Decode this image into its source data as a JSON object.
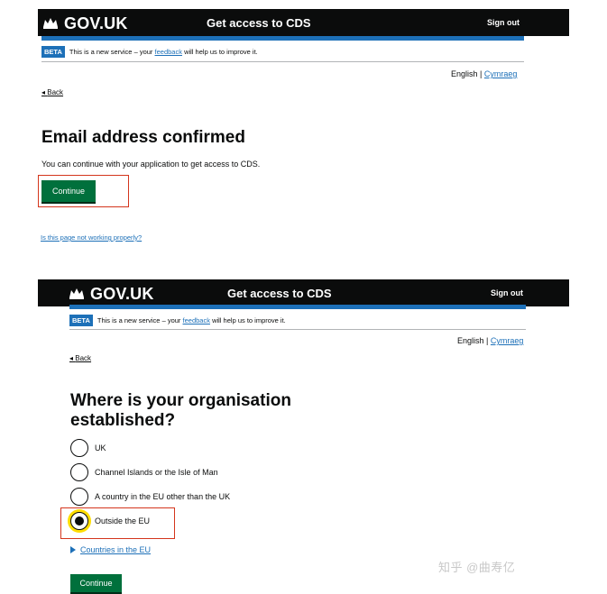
{
  "common": {
    "logo_text": "GOV.UK",
    "service_name": "Get access to CDS",
    "sign_out": "Sign out",
    "beta_tag": "BETA",
    "beta_prefix": "This is a new service – your",
    "beta_link": "feedback",
    "beta_suffix": "will help us to improve it.",
    "lang_english": "English",
    "lang_separator": "|",
    "lang_welsh": "Cymraeg",
    "back": "Back"
  },
  "screen1": {
    "title": "Email address confirmed",
    "body": "You can continue with your application to get access to CDS.",
    "continue": "Continue",
    "help_link": "Is this page not working properly?"
  },
  "screen2": {
    "title_line1": "Where is your organisation",
    "title_line2": "established?",
    "options": [
      {
        "label": "UK",
        "checked": false
      },
      {
        "label": "Channel Islands or the Isle of Man",
        "checked": false
      },
      {
        "label": "A country in the EU other than the UK",
        "checked": false
      },
      {
        "label": "Outside the EU",
        "checked": true
      }
    ],
    "details_summary": "Countries in the EU",
    "continue": "Continue"
  },
  "watermark": "知乎 @曲寿亿",
  "colors": {
    "header_bg": "#0b0c0c",
    "brand_blue": "#1d70b8",
    "button_green": "#00703c",
    "highlight_red": "#d4351c",
    "focus_yellow": "#ffdd00"
  }
}
